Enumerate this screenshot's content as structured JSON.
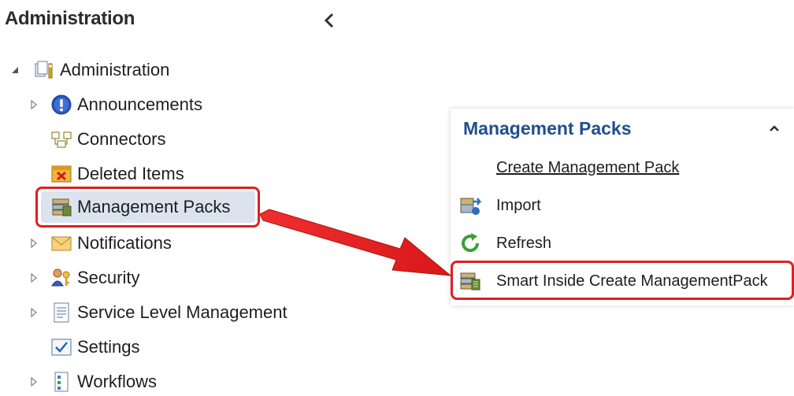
{
  "header": {
    "title": "Administration",
    "collapse_icon": "chevron-left-icon"
  },
  "tree": {
    "root": {
      "label": "Administration",
      "icon": "administration-icon",
      "expanded": true
    },
    "items": [
      {
        "label": "Announcements",
        "icon": "announcement-info-icon",
        "has_children": true
      },
      {
        "label": "Connectors",
        "icon": "connectors-icon",
        "has_children": false
      },
      {
        "label": "Deleted Items",
        "icon": "deleted-items-icon",
        "has_children": false
      },
      {
        "label": "Management Packs",
        "icon": "management-packs-icon",
        "has_children": false,
        "selected": true
      },
      {
        "label": "Notifications",
        "icon": "envelope-icon",
        "has_children": true
      },
      {
        "label": "Security",
        "icon": "security-users-icon",
        "has_children": true
      },
      {
        "label": "Service Level Management",
        "icon": "document-icon",
        "has_children": true
      },
      {
        "label": "Settings",
        "icon": "settings-check-icon",
        "has_children": false
      },
      {
        "label": "Workflows",
        "icon": "workflows-icon",
        "has_children": true
      }
    ]
  },
  "tasks_panel": {
    "title": "Management Packs",
    "collapse_icon": "chevron-up-icon",
    "items": [
      {
        "label": "Create Management Pack",
        "icon": "none",
        "link": true
      },
      {
        "label": "Import",
        "icon": "import-icon"
      },
      {
        "label": "Refresh",
        "icon": "refresh-icon"
      },
      {
        "label": "Smart Inside Create ManagementPack",
        "icon": "management-pack-icon",
        "highlighted": true
      }
    ]
  },
  "colors": {
    "highlight_red": "#e02020",
    "panel_title_blue": "#1f4f8f",
    "selection_bg": "#dbe4ee"
  }
}
